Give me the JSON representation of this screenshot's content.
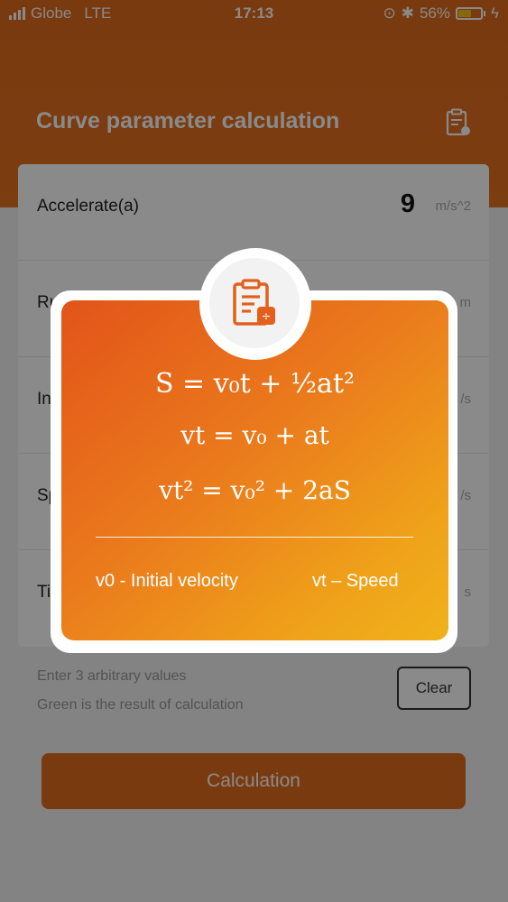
{
  "status_bar": {
    "carrier": "Globe",
    "network": "LTE",
    "time": "17:13",
    "battery": "56%"
  },
  "header": {
    "title": "Curve parameter calculation",
    "icon": "clipboard-icon"
  },
  "fields": [
    {
      "label": "Accelerate(a)",
      "value": "9",
      "unit": "m/s^2"
    },
    {
      "label": "Ru",
      "value": "",
      "unit": "m"
    },
    {
      "label": "In",
      "value": "",
      "unit": "/s"
    },
    {
      "label": "Sp",
      "value": "",
      "unit": "/s"
    },
    {
      "label": "Ti",
      "value": "",
      "unit": "s"
    }
  ],
  "hints": {
    "line1": "Enter 3 arbitrary values",
    "line2": "Green is the result of calculation"
  },
  "buttons": {
    "clear": "Clear",
    "calculate": "Calculation"
  },
  "popup": {
    "icon": "formula-clipboard-icon",
    "formula1": "S = v₀t + ½at²",
    "formula2": "vt = v₀ + at",
    "formula3": "vt² = v₀² + 2aS",
    "legend_left": "v0 - Initial velocity",
    "legend_right": "vt – Speed"
  },
  "colors": {
    "accent": "#e26c1e",
    "popup_gradient_start": "#e2541a",
    "popup_gradient_end": "#f0b21a"
  }
}
